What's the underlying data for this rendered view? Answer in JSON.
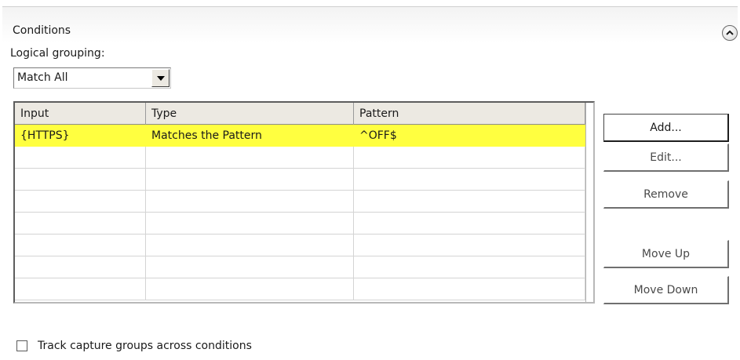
{
  "section": {
    "title": "Conditions",
    "collapse_icon": "chevron-up-circle-icon"
  },
  "logical_grouping": {
    "label": "Logical grouping:",
    "selected": "Match All"
  },
  "conditions_table": {
    "columns": [
      "Input",
      "Type",
      "Pattern"
    ],
    "rows": [
      {
        "input": "{HTTPS}",
        "type": "Matches the Pattern",
        "pattern": "^OFF$",
        "selected": true
      }
    ],
    "empty_rows": 7,
    "highlight_color": "#ffff40"
  },
  "buttons": {
    "add": "Add...",
    "edit": "Edit...",
    "remove": "Remove",
    "move_up": "Move Up",
    "move_down": "Move Down"
  },
  "track_capture": {
    "label": "Track capture groups across conditions",
    "checked": false
  }
}
